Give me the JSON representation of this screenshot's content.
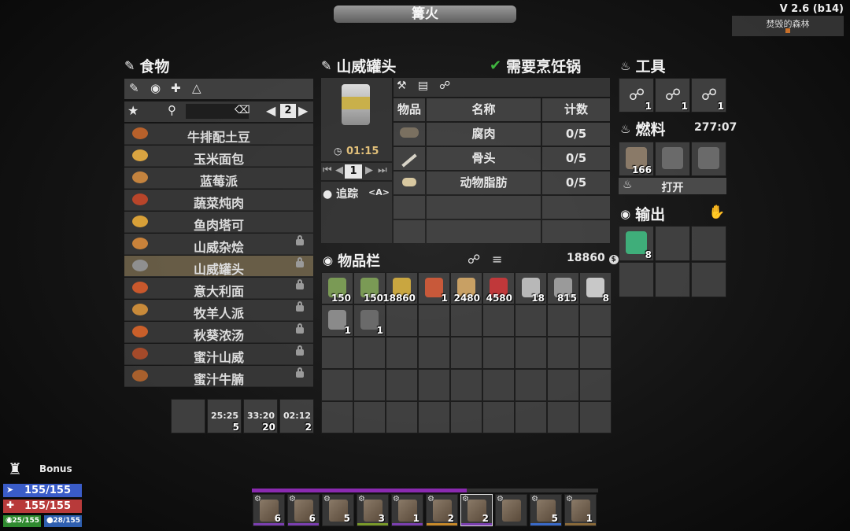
{
  "window_title": "篝火",
  "version": {
    "label": "V 2.6 (b14)",
    "location": "焚毁的森林"
  },
  "food": {
    "title": "食物",
    "page": "2",
    "items": [
      {
        "name": "牛排配土豆",
        "locked": false,
        "color": "#b8612b"
      },
      {
        "name": "玉米面包",
        "locked": false,
        "color": "#d9a441"
      },
      {
        "name": "蓝莓派",
        "locked": false,
        "color": "#c4833e"
      },
      {
        "name": "蔬菜炖肉",
        "locked": false,
        "color": "#b8452a"
      },
      {
        "name": "鱼肉塔可",
        "locked": false,
        "color": "#d8a038"
      },
      {
        "name": "山威杂烩",
        "locked": true,
        "color": "#c9823a"
      },
      {
        "name": "山威罐头",
        "locked": true,
        "color": "#8f8f8f"
      },
      {
        "name": "意大利面",
        "locked": true,
        "color": "#c9582c"
      },
      {
        "name": "牧羊人派",
        "locked": true,
        "color": "#c88a3a"
      },
      {
        "name": "秋葵浓汤",
        "locked": true,
        "color": "#c95f2a"
      },
      {
        "name": "蜜汁山威",
        "locked": true,
        "color": "#a44a2a"
      },
      {
        "name": "蜜汁牛腩",
        "locked": true,
        "color": "#a8602d"
      }
    ],
    "queue": [
      {
        "time": "",
        "count": ""
      },
      {
        "time": "25:25",
        "count": "5"
      },
      {
        "time": "33:20",
        "count": "20"
      },
      {
        "time": "02:12",
        "count": "2"
      }
    ]
  },
  "recipe": {
    "title": "山威罐头",
    "requirement": "需要烹饪锅",
    "craft_time": "01:15",
    "quantity": "1",
    "track_label": "追踪",
    "track_key": "<A>",
    "headers": {
      "item": "物品",
      "name": "名称",
      "count": "计数"
    },
    "ingredients": [
      {
        "name": "腐肉",
        "count": "0/5"
      },
      {
        "name": "骨头",
        "count": "0/5"
      },
      {
        "name": "动物脂肪",
        "count": "0/5"
      }
    ]
  },
  "inventory": {
    "title": "物品栏",
    "currency": "18860",
    "items": [
      {
        "count": "150",
        "color": "#7a9a55"
      },
      {
        "count": "150",
        "color": "#7a9a55"
      },
      {
        "count": "18860",
        "color": "#c9a640"
      },
      {
        "count": "1",
        "color": "#c8593a"
      },
      {
        "count": "2480",
        "color": "#c8a064"
      },
      {
        "count": "4580",
        "color": "#c0383a"
      },
      {
        "count": "18",
        "color": "#b8b8b8"
      },
      {
        "count": "815",
        "color": "#9a9a9a"
      },
      {
        "count": "8",
        "color": "#c8c8c8"
      },
      {
        "count": "1",
        "color": "#8a8a8a"
      },
      {
        "count": "1",
        "color": "#6a6a6a"
      }
    ]
  },
  "tools": {
    "title": "工具",
    "slots": [
      "1",
      "1",
      "1"
    ]
  },
  "fuel": {
    "title": "燃料",
    "time": "277:07",
    "slots": [
      "166",
      "",
      ""
    ],
    "open_label": "打开"
  },
  "output": {
    "title": "输出",
    "slots": [
      {
        "count": "8",
        "color": "#3fae7a"
      }
    ]
  },
  "player": {
    "bonus_label": "Bonus",
    "stamina": "155/155",
    "health": "155/155",
    "food": "125/155",
    "water": "128/155"
  },
  "belt": [
    {
      "count": "6",
      "quality_color": "#7b3fb0"
    },
    {
      "count": "6",
      "quality_color": "#7b3fb0"
    },
    {
      "count": "5",
      "quality_color": ""
    },
    {
      "count": "3",
      "quality_color": "#7a9a2a"
    },
    {
      "count": "1",
      "quality_color": "#7b3fb0"
    },
    {
      "count": "2",
      "quality_color": "#c88a2a"
    },
    {
      "count": "2",
      "quality_color": "#7b3fb0"
    },
    {
      "count": "",
      "quality_color": ""
    },
    {
      "count": "5",
      "quality_color": "#3a6ac8"
    },
    {
      "count": "1",
      "quality_color": "#8a6a3a"
    }
  ],
  "colors": {
    "accent": "#3fb53f",
    "stamina": "#3a5cc8",
    "health": "#b83a3a",
    "food_bar": "#2f8a2f",
    "water_bar": "#2f5fb0"
  }
}
